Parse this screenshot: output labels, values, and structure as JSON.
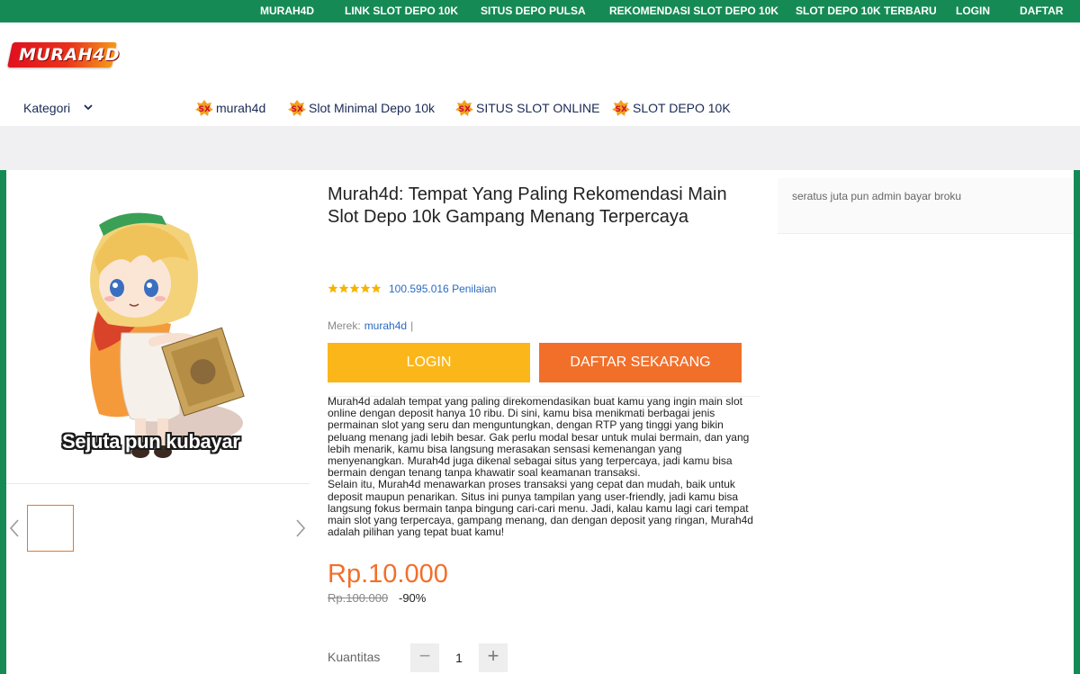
{
  "top_nav": {
    "items": [
      "MURAH4D",
      "LINK SLOT DEPO 10K",
      "SITUS DEPO PULSA",
      "REKOMENDASI SLOT DEPO 10K",
      "SLOT DEPO 10K TERBARU",
      "LOGIN",
      "DAFTAR"
    ]
  },
  "logo": {
    "text": "MURAH4D"
  },
  "category_bar": {
    "kategori_label": "Kategori",
    "links": [
      "murah4d",
      "Slot Minimal Depo 10k",
      "SITUS SLOT ONLINE",
      "SLOT DEPO 10K"
    ]
  },
  "gallery": {
    "caption": "Sejuta pun kubayar"
  },
  "product": {
    "title": "Murah4d: Tempat Yang Paling Rekomendasi Main Slot Depo 10k Gampang Menang Terpercaya",
    "rating": {
      "stars": 5,
      "count_text": "100.595.016 Penilaian"
    },
    "brand_label": "Merek:",
    "brand_value": "murah4d",
    "brand_separator": "|",
    "login_button": "LOGIN",
    "daftar_button": "DAFTAR SEKARANG",
    "description": [
      "Murah4d adalah tempat yang paling direkomendasikan buat kamu yang ingin main slot online dengan deposit hanya 10 ribu. Di sini, kamu bisa menikmati berbagai jenis permainan slot yang seru dan menguntungkan, dengan RTP yang tinggi yang bikin peluang menang jadi lebih besar. Gak perlu modal besar untuk mulai bermain, dan yang lebih menarik, kamu bisa langsung merasakan sensasi kemenangan yang menyenangkan. Murah4d juga dikenal sebagai situs yang terpercaya, jadi kamu bisa bermain dengan tenang tanpa khawatir soal keamanan transaksi.",
      "Selain itu, Murah4d menawarkan proses transaksi yang cepat dan mudah, baik untuk deposit maupun penarikan. Situs ini punya tampilan yang user-friendly, jadi kamu bisa langsung fokus bermain tanpa bingung cari-cari menu. Jadi, kalau kamu lagi cari tempat main slot yang terpercaya, gampang menang, dan dengan deposit yang ringan, Murah4d adalah pilihan yang tepat buat kamu!"
    ],
    "price": "Rp.10.000",
    "old_price": "Rp.100.000",
    "discount": "-90%",
    "quantity_label": "Kuantitas",
    "quantity_value": "1",
    "minus": "−",
    "plus": "+"
  },
  "sidebar": {
    "text": "seratus juta pun admin bayar broku"
  },
  "colors": {
    "green": "#168a55",
    "orange": "#f26f2a",
    "yellow": "#fbb619",
    "link": "#2a6bc1"
  }
}
